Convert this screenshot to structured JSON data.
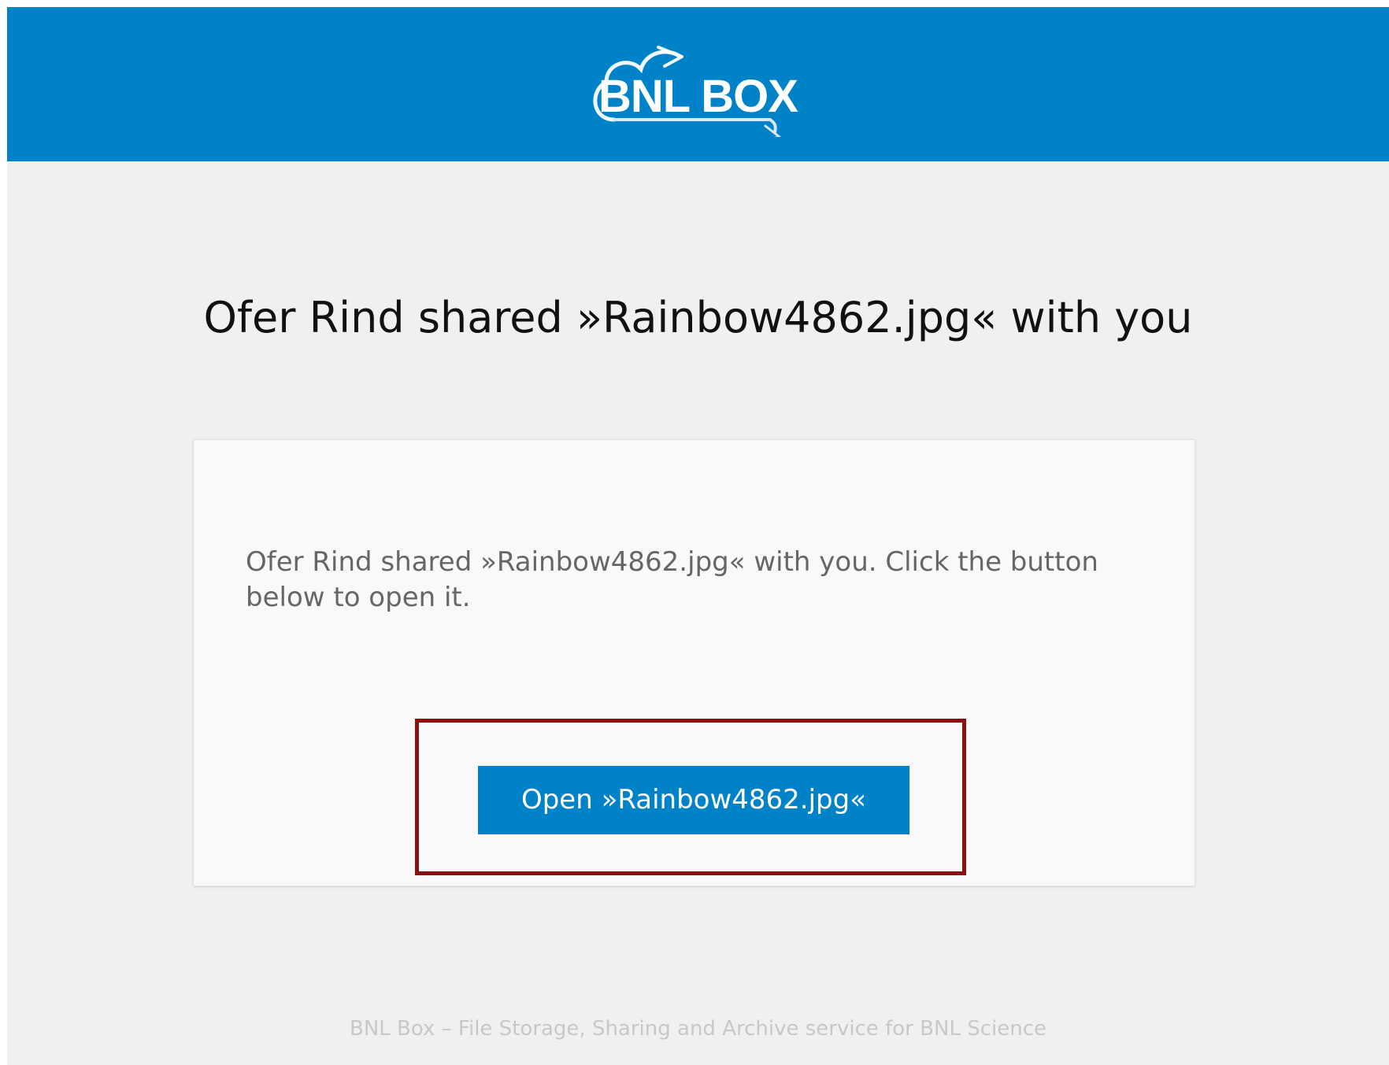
{
  "header": {
    "logo_text": "BNL BOX",
    "background_color": "#0082c9"
  },
  "headline": "Ofer Rind shared »Rainbow4862.jpg« with you",
  "card": {
    "message": "Ofer Rind shared »Rainbow4862.jpg« with you. Click the button below to open it.",
    "button_label": "Open »Rainbow4862.jpg«",
    "button_color": "#0082c9",
    "highlight_color": "#8b1111"
  },
  "footer": {
    "text": "BNL Box – File Storage, Sharing and Archive service for BNL Science"
  },
  "icons": {
    "logo": "cloud-logo-icon"
  }
}
